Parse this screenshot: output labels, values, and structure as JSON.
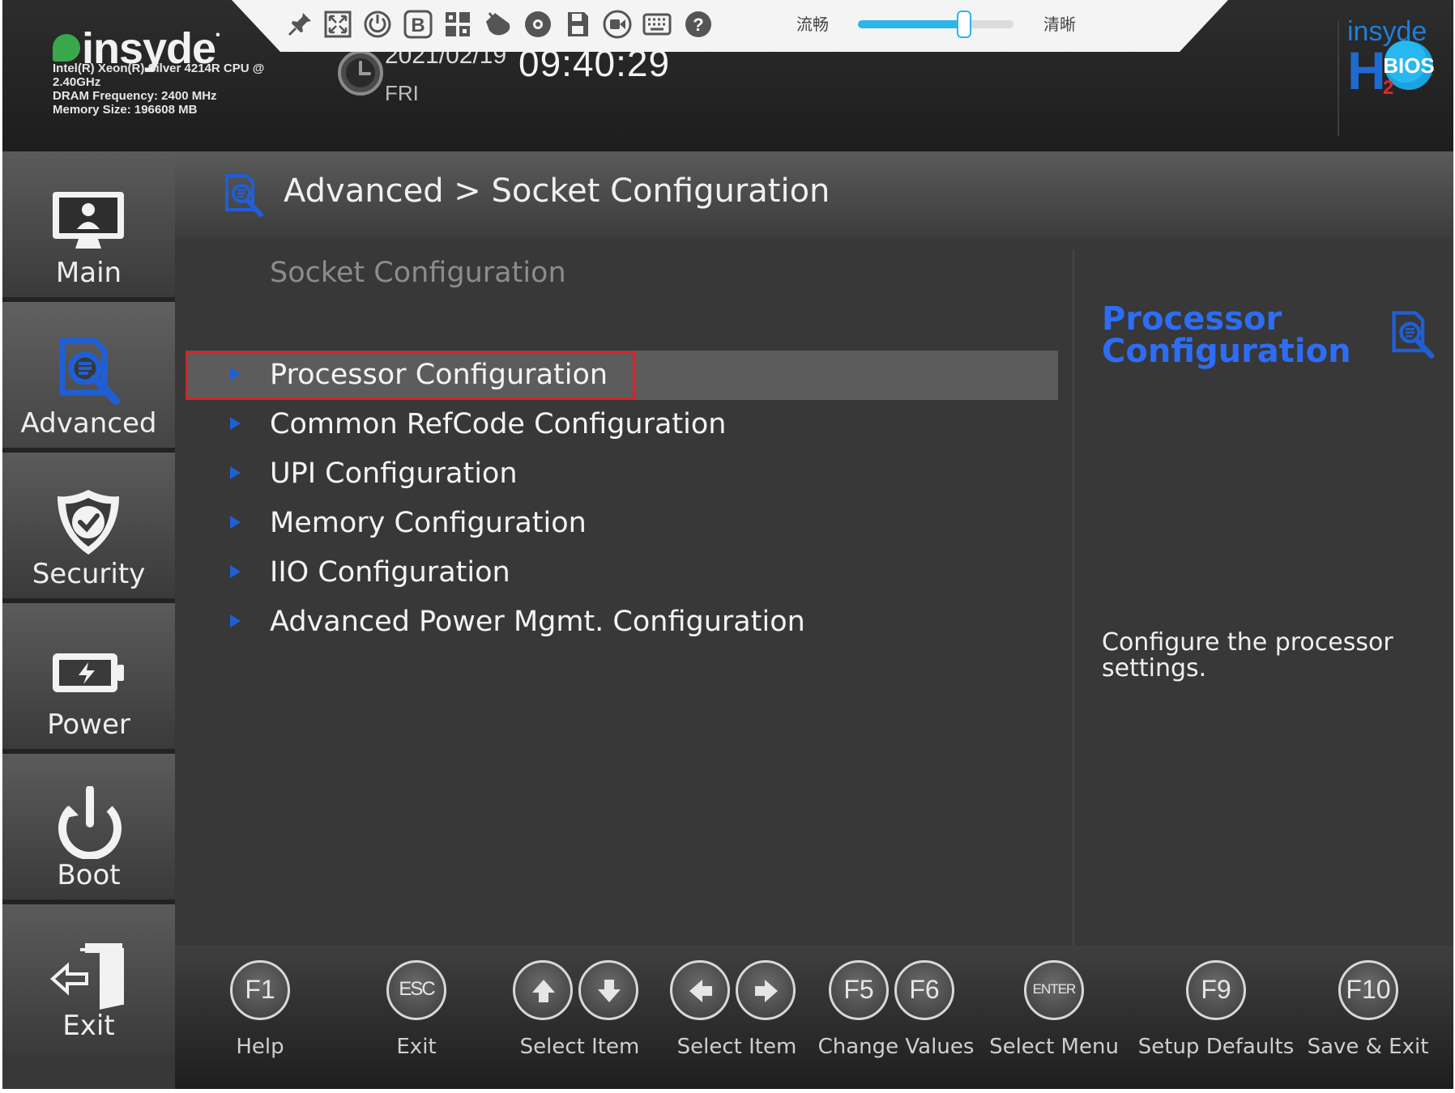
{
  "header": {
    "brand": "insyde",
    "cpu": "Intel(R) Xeon(R) Silver 4214R CPU @ 2.40GHz",
    "dram": "DRAM Frequency: 2400 MHz",
    "memory": "Memory Size: 196608 MB",
    "date": "2021/02/19",
    "day": "FRI",
    "time": "09:40:29",
    "logo_top": "insyde",
    "logo_badge": "BIOS",
    "logo_letter": "H",
    "logo_sub": "2"
  },
  "toolbar": {
    "icons": [
      "pin-icon",
      "fullscreen-icon",
      "power-icon",
      "bold-b-icon",
      "keyboard-grid-icon",
      "mouse-icon",
      "disc-icon",
      "save-icon",
      "record-icon",
      "virtual-keyboard-icon",
      "help-icon"
    ],
    "quality_left_label": "流畅",
    "quality_right_label": "清晰",
    "quality_level": 0.68,
    "accent_color": "#2bb6e8"
  },
  "sidebar": {
    "items": [
      {
        "label": "Main",
        "icon": "monitor-user-icon"
      },
      {
        "label": "Advanced",
        "icon": "advanced-search-icon",
        "active": true
      },
      {
        "label": "Security",
        "icon": "shield-check-icon"
      },
      {
        "label": "Power",
        "icon": "battery-icon"
      },
      {
        "label": "Boot",
        "icon": "power-icon"
      },
      {
        "label": "Exit",
        "icon": "exit-door-icon"
      }
    ]
  },
  "breadcrumb": "Advanced > Socket Configuration",
  "section_title": "Socket Configuration",
  "menu": {
    "items": [
      "Processor Configuration",
      "Common RefCode Configuration",
      "UPI Configuration",
      "Memory Configuration",
      "IIO Configuration",
      "Advanced Power Mgmt. Configuration"
    ],
    "selected_index": 0,
    "arrow_color": "#1f5fd6",
    "focus_color": "#d8232a"
  },
  "help": {
    "title": "Processor Configuration",
    "text": "Configure the processor settings.",
    "title_color": "#2d6df6"
  },
  "footer": {
    "keys": [
      {
        "keys": [
          "F1"
        ],
        "caption": "Help"
      },
      {
        "keys": [
          "ESC"
        ],
        "caption": "Exit"
      },
      {
        "keys": [
          "arrow-up-icon",
          "arrow-down-icon"
        ],
        "caption": "Select Item"
      },
      {
        "keys": [
          "arrow-left-icon",
          "arrow-right-icon"
        ],
        "caption": "Select Item"
      },
      {
        "keys": [
          "F5",
          "F6"
        ],
        "caption": "Change Values"
      },
      {
        "keys": [
          "ENTER"
        ],
        "caption": "Select Menu"
      },
      {
        "keys": [
          "F9"
        ],
        "caption": "Setup Defaults"
      },
      {
        "keys": [
          "F10"
        ],
        "caption": "Save & Exit"
      }
    ]
  }
}
